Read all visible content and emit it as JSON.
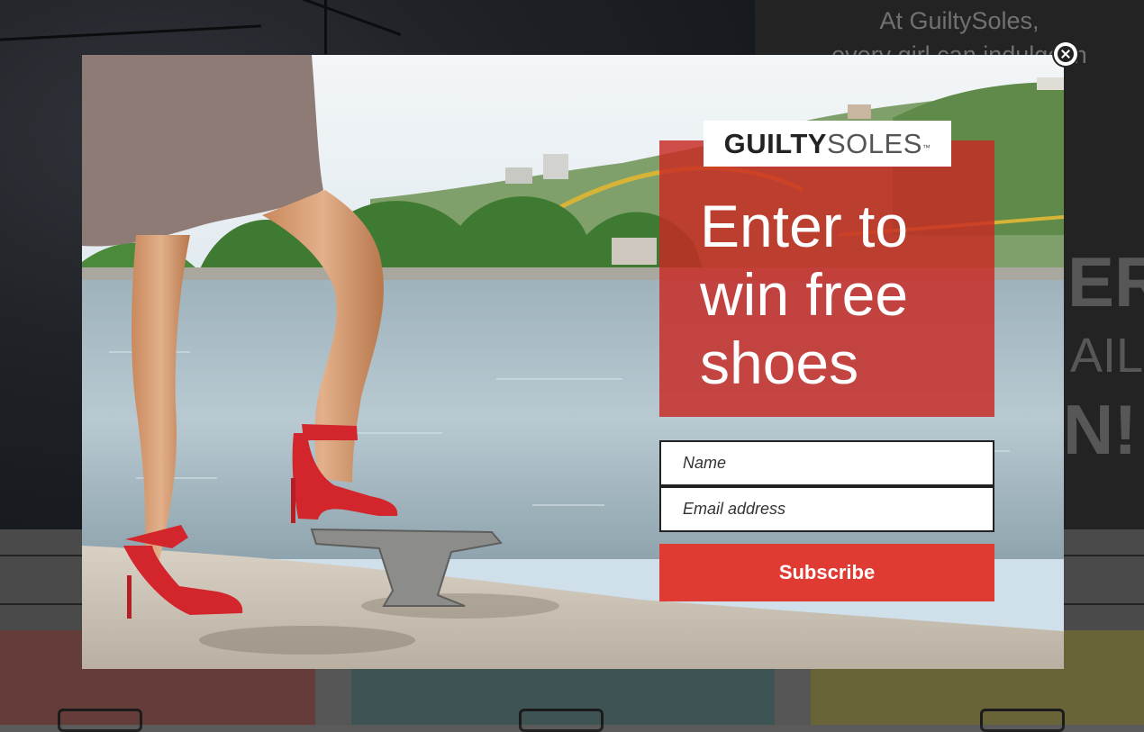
{
  "background_page": {
    "tagline": "At GuiltySoles,\nevery girl can indulge in\npleasure.",
    "big_letters_1": "ER",
    "mid_letters": "AIL",
    "big_letters_2": "N!"
  },
  "popup": {
    "logo": {
      "bold": "GUILTY",
      "light": "SOLES",
      "tm": "™"
    },
    "headline": "Enter to\nwin free\nshoes",
    "name_placeholder": "Name",
    "email_placeholder": "Email address",
    "subscribe_label": "Subscribe",
    "close_icon": "close-x-circle-icon"
  },
  "colors": {
    "accent_red": "#e03b33",
    "panel_red": "#c82822"
  }
}
